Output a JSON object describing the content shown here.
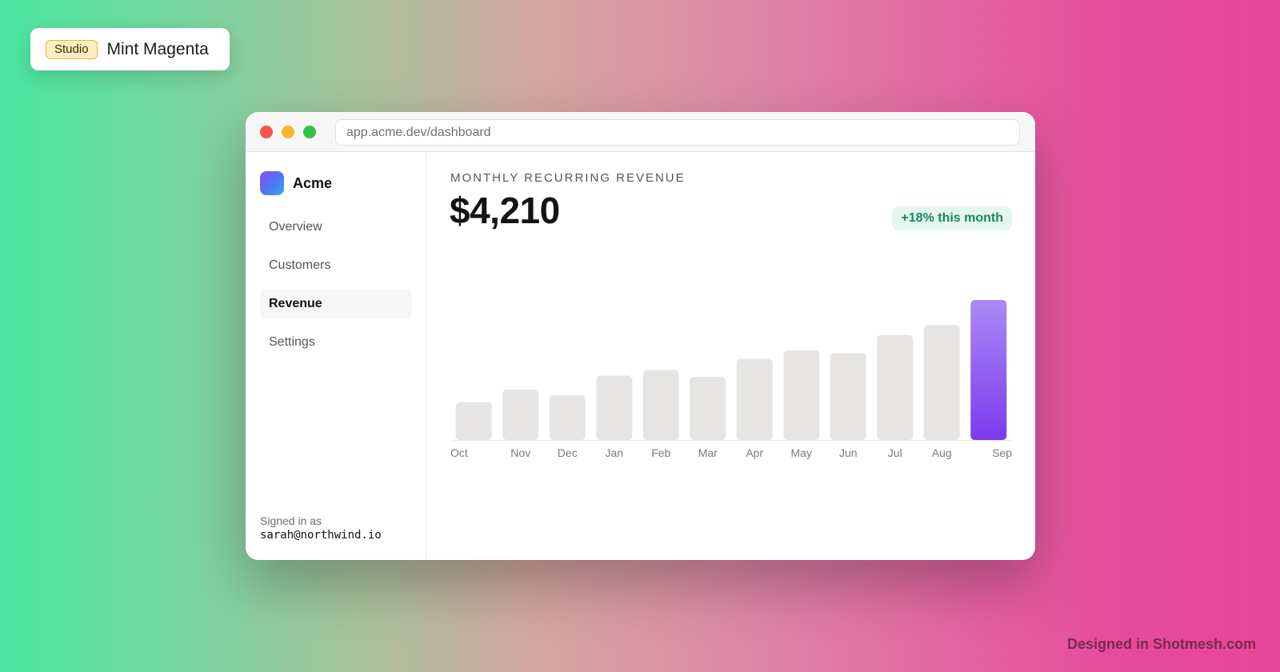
{
  "badge": {
    "tag": "Studio",
    "name": "Mint Magenta"
  },
  "window": {
    "url": "app.acme.dev/dashboard"
  },
  "sidebar": {
    "brand": "Acme",
    "items": [
      {
        "label": "Overview"
      },
      {
        "label": "Customers"
      },
      {
        "label": "Revenue",
        "active": true
      },
      {
        "label": "Settings"
      }
    ],
    "signed_in_label": "Signed in as",
    "signed_in_email": "sarah@northwind.io"
  },
  "main": {
    "kpi_label": "MONTHLY RECURRING REVENUE",
    "kpi_value": "$4,210",
    "trend": "+18% this month"
  },
  "chart_data": {
    "type": "bar",
    "categories": [
      "Oct",
      "Nov",
      "Dec",
      "Jan",
      "Feb",
      "Mar",
      "Apr",
      "May",
      "Jun",
      "Jul",
      "Aug",
      "Sep"
    ],
    "values": [
      27,
      36,
      32,
      46,
      50,
      45,
      58,
      64,
      62,
      75,
      82,
      100
    ],
    "ylim": [
      0,
      100
    ],
    "highlight_index": 11,
    "colors": {
      "bar": "#e6e5e3",
      "highlight_top": "#a98af5",
      "highlight_bottom": "#7c3aed",
      "axis": "#e8e8e8"
    }
  },
  "footer": {
    "credit": "Designed in Shotmesh.com"
  }
}
